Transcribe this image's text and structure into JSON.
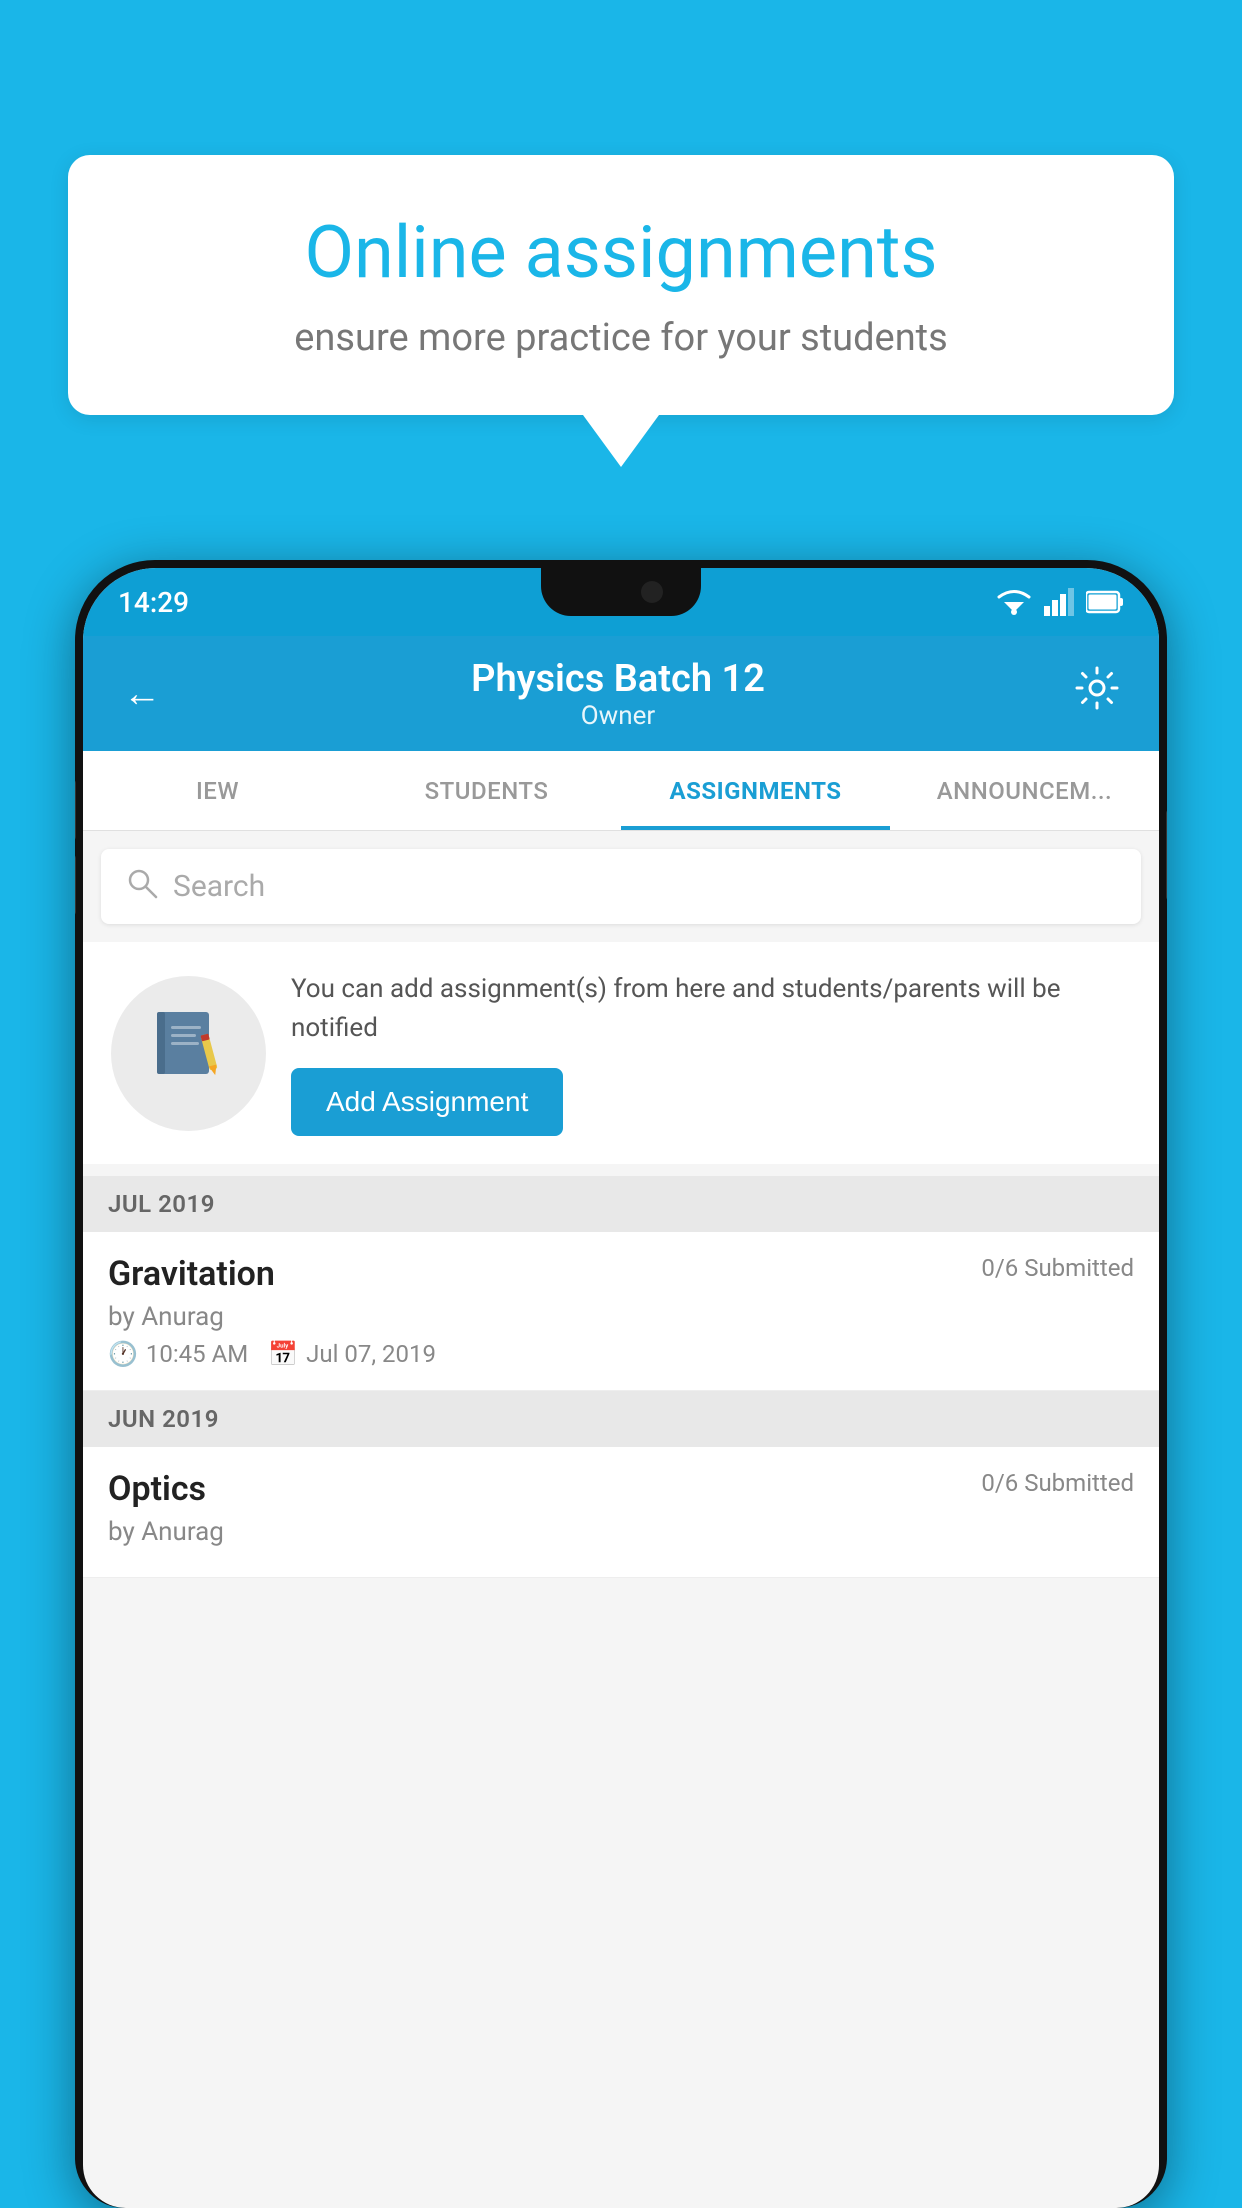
{
  "background_color": "#1ab6e8",
  "speech_bubble": {
    "title": "Online assignments",
    "subtitle": "ensure more practice for your students"
  },
  "status_bar": {
    "time": "14:29",
    "icons": [
      "wifi",
      "signal",
      "battery"
    ]
  },
  "top_bar": {
    "title": "Physics Batch 12",
    "subtitle": "Owner",
    "back_label": "←",
    "settings_label": "⚙"
  },
  "tabs": [
    {
      "label": "IEW",
      "active": false
    },
    {
      "label": "STUDENTS",
      "active": false
    },
    {
      "label": "ASSIGNMENTS",
      "active": true
    },
    {
      "label": "ANNOUNCEM...",
      "active": false
    }
  ],
  "search": {
    "placeholder": "Search"
  },
  "promo_card": {
    "text": "You can add assignment(s) from here and students/parents will be notified",
    "button_label": "Add Assignment"
  },
  "sections": [
    {
      "month": "JUL 2019",
      "assignments": [
        {
          "title": "Gravitation",
          "submitted": "0/6 Submitted",
          "by": "by Anurag",
          "time": "10:45 AM",
          "date": "Jul 07, 2019"
        }
      ]
    },
    {
      "month": "JUN 2019",
      "assignments": [
        {
          "title": "Optics",
          "submitted": "0/6 Submitted",
          "by": "by Anurag",
          "time": "",
          "date": ""
        }
      ]
    }
  ]
}
